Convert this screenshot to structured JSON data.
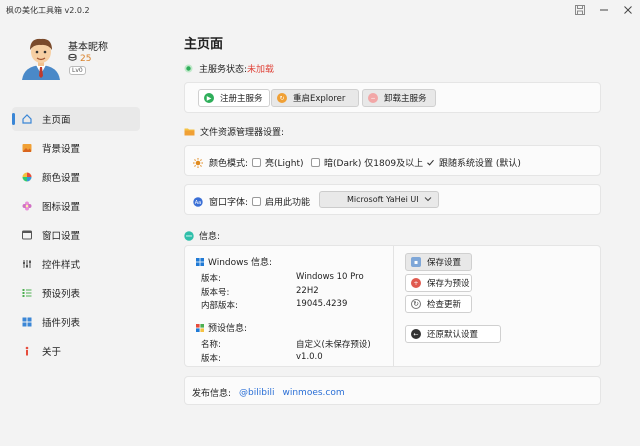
{
  "window": {
    "title": "枫の美化工具箱 v2.0.2"
  },
  "profile": {
    "nickname": "基本昵称",
    "coins": "25",
    "level": "Lv0"
  },
  "nav": [
    {
      "label": "主页面",
      "icon": "home-icon",
      "active": true
    },
    {
      "label": "背景设置",
      "icon": "image-icon"
    },
    {
      "label": "颜色设置",
      "icon": "palette-icon"
    },
    {
      "label": "图标设置",
      "icon": "flower-icon"
    },
    {
      "label": "窗口设置",
      "icon": "window-icon"
    },
    {
      "label": "控件样式",
      "icon": "controls-icon"
    },
    {
      "label": "预设列表",
      "icon": "list-icon"
    },
    {
      "label": "插件列表",
      "icon": "plugin-icon"
    },
    {
      "label": "关于",
      "icon": "info-icon"
    }
  ],
  "main": {
    "title": "主页面",
    "service_status_label": "主服务状态:",
    "service_status_value": "未加载",
    "buttons": {
      "register": "注册主服务",
      "restart": "重启Explorer",
      "uninstall": "卸载主服务"
    },
    "explorer_section": "文件资源管理器设置:",
    "color_mode": {
      "label": "颜色模式:",
      "light": "亮(Light)",
      "dark": "暗(Dark) 仅1809及以上",
      "follow": "跟随系统设置 (默认)"
    },
    "font": {
      "label": "窗口字体:",
      "enable": "启用此功能",
      "selected": "Microsoft YaHei UI"
    },
    "info_section": "信息:",
    "windows_info": {
      "title": "Windows 信息:",
      "rows": [
        {
          "k": "版本:",
          "v": "Windows 10 Pro"
        },
        {
          "k": "版本号:",
          "v": "22H2"
        },
        {
          "k": "内部版本:",
          "v": "19045.4239"
        }
      ]
    },
    "preset_info": {
      "title": "预设信息:",
      "rows": [
        {
          "k": "名称:",
          "v": "自定义(未保存预设)"
        },
        {
          "k": "版本:",
          "v": "v1.0.0"
        }
      ]
    },
    "actions": {
      "save": "保存设置",
      "save_preset": "保存为预设",
      "check_update": "检查更新",
      "restore": "还原默认设置"
    },
    "release": {
      "label": "发布信息:",
      "link1": "@bilibili",
      "link2": "winmoes.com"
    }
  },
  "colors": {
    "accent": "#3a86d6",
    "status_red": "#e0443a",
    "link": "#2a6fd6"
  }
}
